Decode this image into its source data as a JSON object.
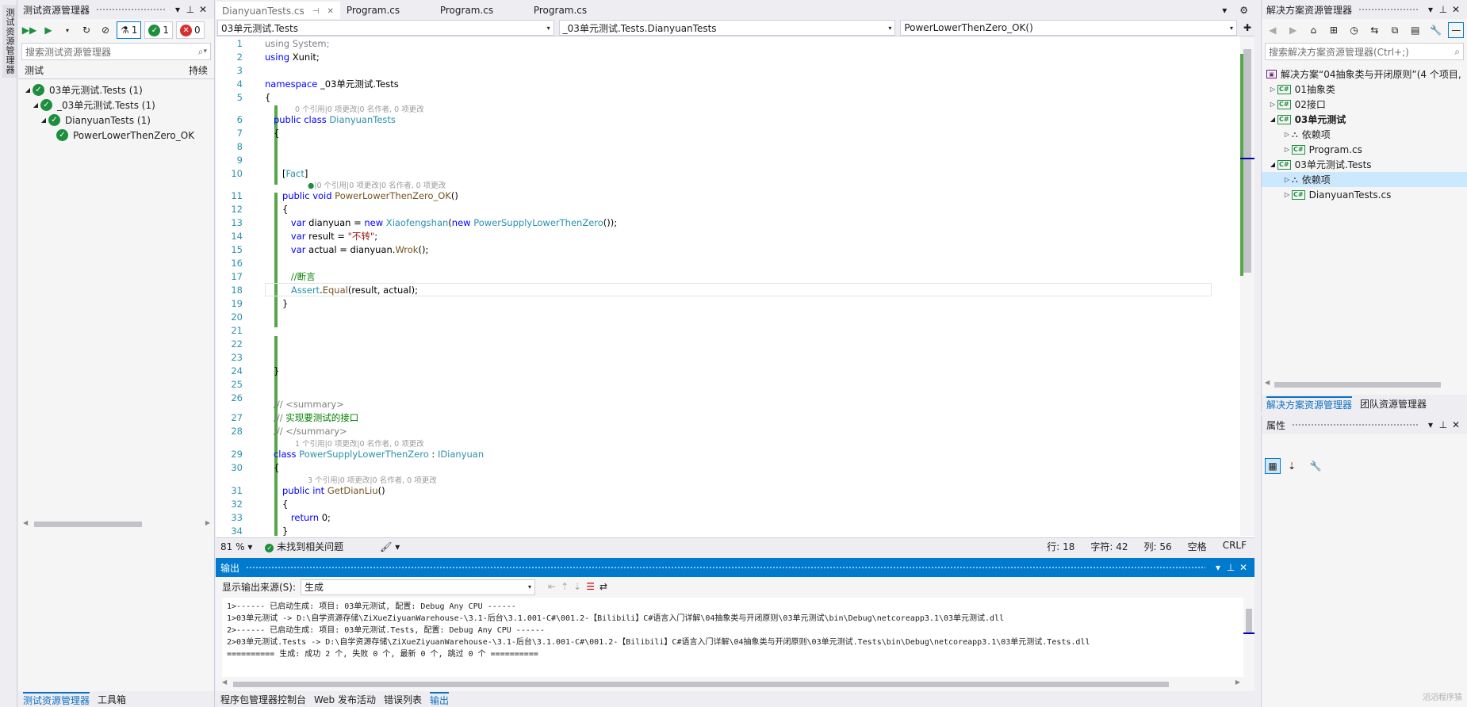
{
  "left_dock_tab": "测试资源管理器",
  "test_explorer": {
    "title": "测试资源管理器",
    "badges": {
      "all": "1",
      "passed": "1",
      "failed": "0"
    },
    "search_placeholder": "搜索测试资源管理器",
    "columns": {
      "test": "测试",
      "duration": "持续"
    },
    "tree": [
      {
        "label": "03单元测试.Tests (1)",
        "level": 0
      },
      {
        "label": "_03单元测试.Tests (1)",
        "level": 1
      },
      {
        "label": "DianyuanTests (1)",
        "level": 2
      },
      {
        "label": "PowerLowerThenZero_OK",
        "level": 3
      }
    ],
    "bottom_tabs": [
      "测试资源管理器",
      "工具箱"
    ]
  },
  "editor": {
    "tabs": [
      {
        "label": "DianyuanTests.cs",
        "active": true
      },
      {
        "label": "Program.cs"
      },
      {
        "label": "Program.cs"
      },
      {
        "label": "Program.cs"
      }
    ],
    "nav": {
      "project": "03单元测试.Tests",
      "class": "_03单元测试.Tests.DianyuanTests",
      "member": "PowerLowerThenZero_OK()"
    },
    "hints": {
      "h_class": "0 个引用|0 项更改|0 名作者, 0 项更改",
      "h_method": "|0 个引用|0 项更改|0 名作者, 0 项更改",
      "h_psclass": "1 个引用|0 项更改|0 名作者, 0 项更改",
      "h_getdl": "3 个引用|0 项更改|0 名作者, 0 项更改"
    },
    "line_numbers": [
      "1",
      "2",
      "3",
      "4",
      "5",
      "6",
      "7",
      "8",
      "9",
      "10",
      "11",
      "12",
      "13",
      "14",
      "15",
      "16",
      "17",
      "18",
      "19",
      "20",
      "21",
      "22",
      "23",
      "24",
      "25",
      "26",
      "27",
      "28",
      "29",
      "30",
      "31",
      "32",
      "33",
      "34"
    ],
    "code": {
      "l1": [
        "using",
        " System;"
      ],
      "l2": [
        "using",
        " Xunit;"
      ],
      "l4": [
        "namespace",
        " _03单元测试.Tests"
      ],
      "l5": "{",
      "l6": [
        "public class",
        " DianyuanTests"
      ],
      "l7": "{",
      "l10": [
        "[",
        "Fact",
        "]"
      ],
      "l11": [
        "public void",
        " PowerLowerThenZero_OK",
        "()"
      ],
      "l12": "{",
      "l13": [
        "var",
        " dianyuan = ",
        "new",
        " Xiaofengshan",
        "(",
        "new",
        " PowerSupplyLowerThenZero",
        "());"
      ],
      "l14": [
        "var",
        " result = ",
        "\"不转\"",
        ";"
      ],
      "l15": [
        "var",
        " actual = dianyuan.",
        "Wrok",
        "();"
      ],
      "l17": "//断言",
      "l18": [
        "Assert",
        ".",
        "Equal",
        "(result, actual);"
      ],
      "l19": "}",
      "l24": "}",
      "l26": [
        "/// <summary>"
      ],
      "l27": [
        "/// ",
        "实现要测试的接口"
      ],
      "l28": [
        "/// </summary>"
      ],
      "l29": [
        "class",
        " PowerSupplyLowerThenZero",
        " : ",
        "IDianyuan"
      ],
      "l30": "{",
      "l31": [
        "public int",
        " GetDianLiu",
        "()"
      ],
      "l32": "{",
      "l33": [
        "return",
        " 0;"
      ],
      "l34": "}"
    },
    "status": {
      "zoom": "81 %",
      "issues": "未找到相关问题",
      "row": "行: 18",
      "char": "字符: 42",
      "col": "列: 56",
      "space": "空格",
      "eol": "CRLF"
    }
  },
  "output": {
    "title": "输出",
    "source_label": "显示输出来源(S):",
    "source_value": "生成",
    "lines": [
      "1>------ 已启动生成: 项目: 03单元测试, 配置: Debug Any CPU ------",
      "1>03单元测试 -> D:\\自学资源存储\\ZiXueZiyuanWarehouse-\\3.1-后台\\3.1.001-C#\\001.2-【Bilibili】C#语言入门详解\\04抽象类与开闭原则\\03单元测试\\bin\\Debug\\netcoreapp3.1\\03单元测试.dll",
      "2>------ 已启动生成: 项目: 03单元测试.Tests, 配置: Debug Any CPU ------",
      "2>03单元测试.Tests -> D:\\自学资源存储\\ZiXueZiyuanWarehouse-\\3.1-后台\\3.1.001-C#\\001.2-【Bilibili】C#语言入门详解\\04抽象类与开闭原则\\03单元测试.Tests\\bin\\Debug\\netcoreapp3.1\\03单元测试.Tests.dll",
      "========== 生成: 成功 2 个, 失败 0 个, 最新 0 个, 跳过 0 个 =========="
    ],
    "bottom_tabs": [
      "程序包管理器控制台",
      "Web 发布活动",
      "错误列表",
      "输出"
    ]
  },
  "solution_explorer": {
    "title": "解决方案资源管理器",
    "search_placeholder": "搜索解决方案资源管理器(Ctrl+;)",
    "tree": [
      {
        "label": "解决方案“04抽象类与开闭原则”(4 个项目,",
        "type": "solution"
      },
      {
        "label": "01抽象类",
        "type": "project"
      },
      {
        "label": "02接口",
        "type": "project"
      },
      {
        "label": "03单元测试",
        "type": "project",
        "bold": true
      },
      {
        "label": "依赖项",
        "type": "deps"
      },
      {
        "label": "Program.cs",
        "type": "cs"
      },
      {
        "label": "03单元测试.Tests",
        "type": "project"
      },
      {
        "label": "依赖项",
        "type": "deps",
        "selected": true
      },
      {
        "label": "DianyuanTests.cs",
        "type": "cs"
      }
    ],
    "bottom_tabs": [
      "解决方案资源管理器",
      "团队资源管理器"
    ]
  },
  "properties": {
    "title": "属性"
  },
  "watermark": "滔滔程序猿"
}
